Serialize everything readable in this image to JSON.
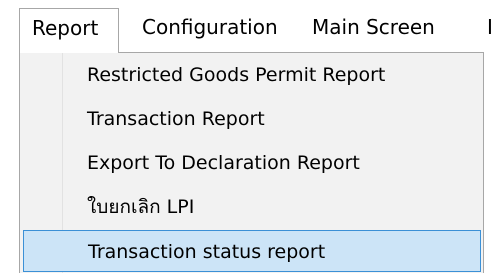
{
  "menubar": {
    "items": [
      {
        "label": "Report"
      },
      {
        "label": "Configuration"
      },
      {
        "label": "Main Screen"
      },
      {
        "label": "I"
      }
    ]
  },
  "report_menu": {
    "items": [
      {
        "label": "Restricted Goods Permit Report"
      },
      {
        "label": "Transaction Report"
      },
      {
        "label": "Export To Declaration Report"
      },
      {
        "label": "ใบยกเลิก LPI"
      },
      {
        "label": "Transaction status report",
        "state": "hovered"
      }
    ]
  },
  "colors": {
    "highlight_bg": "#cce4f7",
    "highlight_border": "#3b90d6",
    "menu_bg": "#f2f2f2",
    "menu_border": "#a7a7a7"
  }
}
